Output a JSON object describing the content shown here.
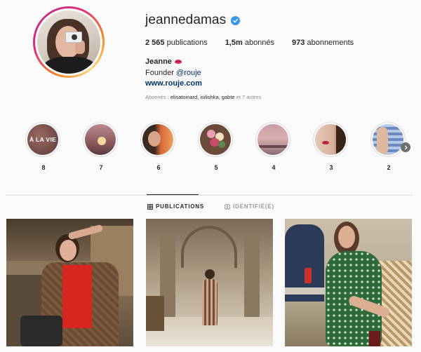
{
  "profile": {
    "username": "jeannedamas",
    "verified": true,
    "stats": {
      "posts_count": "2 565",
      "posts_label": "publications",
      "followers_count": "1,5m",
      "followers_label": "abonnés",
      "following_count": "973",
      "following_label": "abonnements"
    },
    "full_name": "Jeanne",
    "bio_prefix": "Founder ",
    "bio_mention": "@rouje",
    "website": "www.rouje.com",
    "followed_by_prefix": "Abonnés : ",
    "followed_by_names": "elisatoinard, isilishka, gabte",
    "followed_by_suffix": " et 7 autres"
  },
  "highlights": [
    {
      "label": "8",
      "cover_text": "À LA VIE",
      "icon": "highlight-cover-a-la-vie"
    },
    {
      "label": "7",
      "cover_text": "",
      "icon": "highlight-cover-sunset"
    },
    {
      "label": "6",
      "cover_text": "",
      "icon": "highlight-cover-portrait"
    },
    {
      "label": "5",
      "cover_text": "",
      "icon": "highlight-cover-flowers"
    },
    {
      "label": "4",
      "cover_text": "",
      "icon": "highlight-cover-sky"
    },
    {
      "label": "3",
      "cover_text": "",
      "icon": "highlight-cover-face"
    },
    {
      "label": "2",
      "cover_text": "",
      "icon": "highlight-cover-gingham"
    }
  ],
  "tabs": {
    "posts_label": "PUBLICATIONS",
    "tagged_label": "IDENTIFIÉ(E)",
    "active": "posts"
  },
  "posts": [
    {
      "icon": "post-street-red-top"
    },
    {
      "icon": "post-opera-hall"
    },
    {
      "icon": "post-green-dress-cafe"
    }
  ],
  "colors": {
    "accent_link": "#003569",
    "verified_blue": "#3897f0",
    "text_primary": "#262626",
    "text_secondary": "#8e8e8e",
    "divider": "#dbdbdb"
  }
}
